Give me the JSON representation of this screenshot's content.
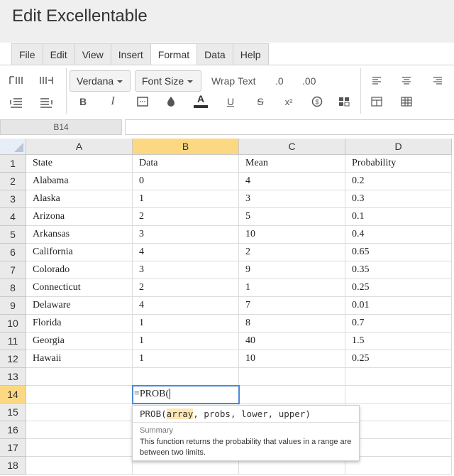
{
  "app": {
    "title": "Edit Excellentable"
  },
  "menu": {
    "tabs": [
      "File",
      "Edit",
      "View",
      "Insert",
      "Format",
      "Data",
      "Help"
    ],
    "active": "Format"
  },
  "toolbar": {
    "font_family": "Verdana",
    "font_size": "Font Size",
    "wrap_text": "Wrap Text",
    "decimal_decrease": ".0",
    "decimal_increase": ".00",
    "bold": "B",
    "italic": "I",
    "text_color": "A",
    "underline": "U",
    "strikethrough": "S",
    "superscript": "x²",
    "accent": "#333333"
  },
  "formula_bar": {
    "cell_ref": "B14",
    "value": ""
  },
  "grid": {
    "columns": [
      "A",
      "B",
      "C",
      "D"
    ],
    "selected_column": "B",
    "selected_row": "14",
    "rows": [
      {
        "num": "1",
        "cells": [
          "State",
          "Data",
          "Mean",
          "Probability"
        ]
      },
      {
        "num": "2",
        "cells": [
          "Alabama",
          "0",
          "4",
          "0.2"
        ]
      },
      {
        "num": "3",
        "cells": [
          "Alaska",
          "1",
          "3",
          "0.3"
        ]
      },
      {
        "num": "4",
        "cells": [
          "Arizona",
          "2",
          "5",
          "0.1"
        ]
      },
      {
        "num": "5",
        "cells": [
          "Arkansas",
          "3",
          "10",
          "0.4"
        ]
      },
      {
        "num": "6",
        "cells": [
          "California",
          "4",
          "2",
          "0.65"
        ]
      },
      {
        "num": "7",
        "cells": [
          "Colorado",
          "3",
          "9",
          "0.35"
        ]
      },
      {
        "num": "8",
        "cells": [
          "Connecticut",
          "2",
          "1",
          "0.25"
        ]
      },
      {
        "num": "9",
        "cells": [
          "Delaware",
          "4",
          "7",
          "0.01"
        ]
      },
      {
        "num": "10",
        "cells": [
          "Florida",
          "1",
          "8",
          "0.7"
        ]
      },
      {
        "num": "11",
        "cells": [
          "Georgia",
          "1",
          "40",
          "1.5"
        ]
      },
      {
        "num": "12",
        "cells": [
          "Hawaii",
          "1",
          "10",
          "0.25"
        ]
      },
      {
        "num": "13",
        "cells": [
          "",
          "",
          "",
          ""
        ]
      },
      {
        "num": "14",
        "cells": [
          "",
          "",
          "",
          ""
        ]
      },
      {
        "num": "15",
        "cells": [
          "",
          "",
          "",
          ""
        ]
      },
      {
        "num": "16",
        "cells": [
          "",
          "",
          "",
          ""
        ]
      },
      {
        "num": "17",
        "cells": [
          "",
          "",
          "",
          ""
        ]
      },
      {
        "num": "18",
        "cells": [
          "",
          "",
          "",
          ""
        ]
      }
    ],
    "selection_color": "#fcd882",
    "editor_border_color": "#4b89dc"
  },
  "cell_editor": {
    "value": "=PROB("
  },
  "autocomplete": {
    "fn_name": "PROB(",
    "active_arg": "array",
    "rest_args": ", probs, lower, upper)",
    "summary_title": "Summary",
    "summary_text": "This function returns the probability that values in a range are between two limits."
  }
}
